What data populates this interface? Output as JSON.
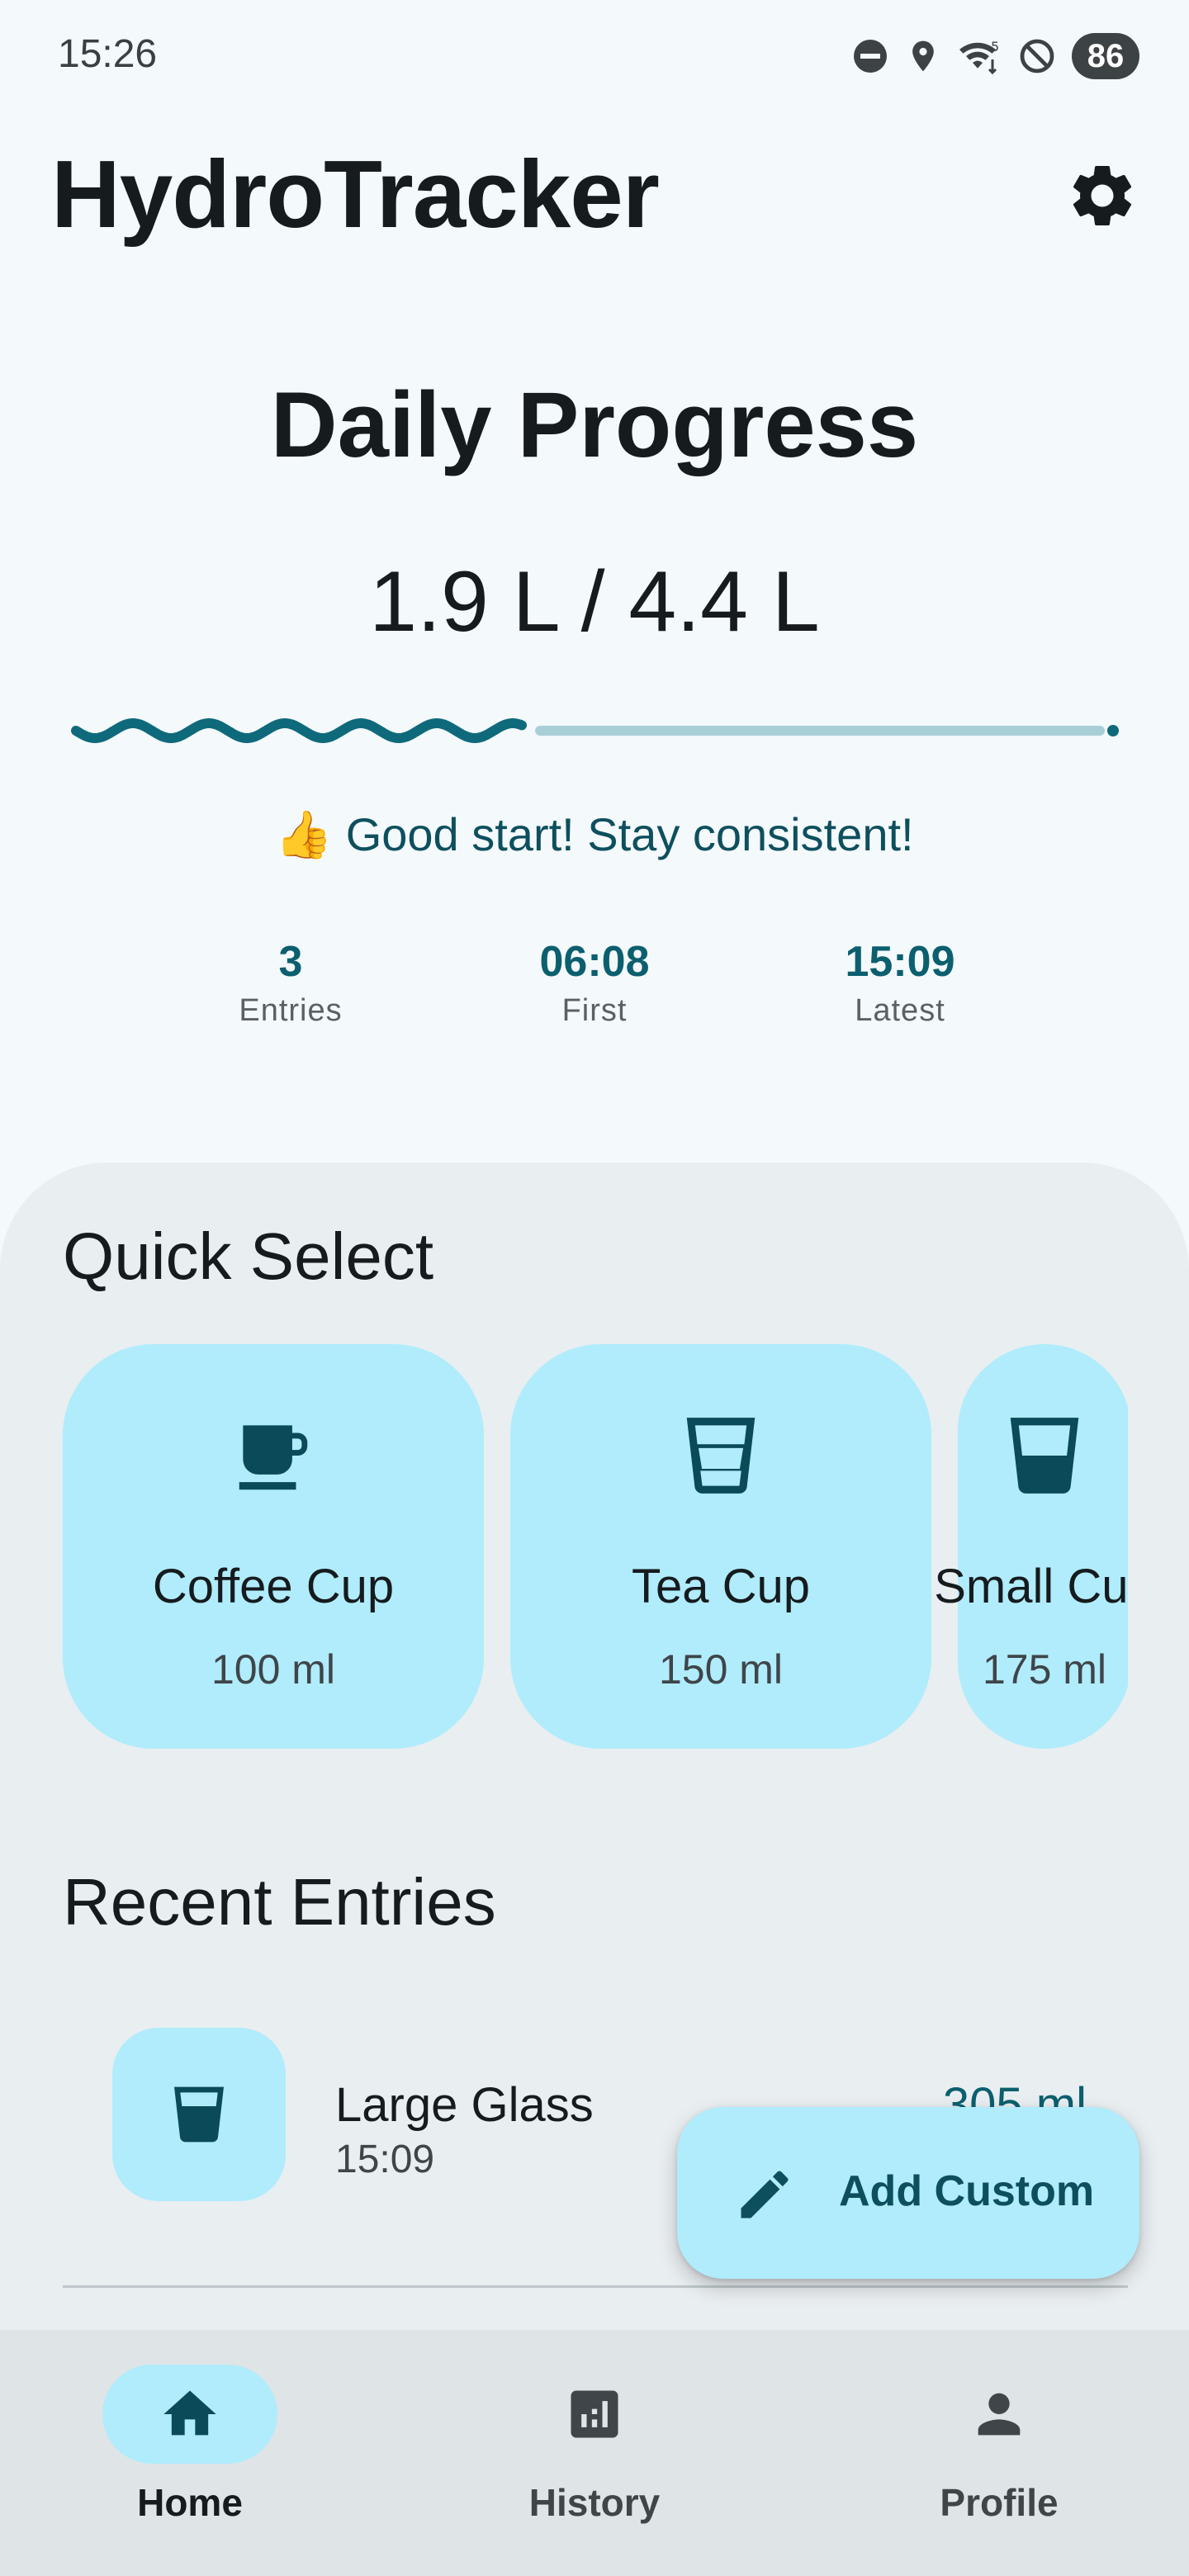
{
  "status_bar": {
    "time": "15:26",
    "battery": "86",
    "icons": [
      "do-not-disturb-icon",
      "location-icon",
      "wifi-icon",
      "blocked-icon",
      "battery-icon"
    ]
  },
  "app_bar": {
    "title": "HydroTracker",
    "settings_icon": "gear-icon"
  },
  "progress": {
    "heading": "Daily Progress",
    "amount": "1.9 L / 4.4 L",
    "consumed_liters": 1.9,
    "goal_liters": 4.4,
    "fraction": 0.43,
    "motivation": "👍 Good start! Stay consistent!"
  },
  "stats": [
    {
      "value": "3",
      "label": "Entries"
    },
    {
      "value": "06:08",
      "label": "First"
    },
    {
      "value": "15:09",
      "label": "Latest"
    }
  ],
  "quick_select": {
    "title": "Quick Select",
    "items": [
      {
        "name": "Coffee Cup",
        "volume": "100 ml",
        "icon": "coffee-cup-icon"
      },
      {
        "name": "Tea Cup",
        "volume": "150 ml",
        "icon": "glass-icon"
      },
      {
        "name": "Small Cup",
        "volume": "175 ml",
        "icon": "glass-icon"
      }
    ]
  },
  "recent_entries": {
    "title": "Recent Entries",
    "items": [
      {
        "name": "Large Glass",
        "time": "15:09",
        "volume": "305 ml",
        "icon": "glass-icon"
      }
    ]
  },
  "fab": {
    "label": "Add Custom",
    "icon": "pencil-icon"
  },
  "bottom_nav": {
    "items": [
      {
        "label": "Home",
        "icon": "home-icon",
        "active": true
      },
      {
        "label": "History",
        "icon": "bar-chart-icon",
        "active": false
      },
      {
        "label": "Profile",
        "icon": "person-icon",
        "active": false
      }
    ]
  },
  "colors": {
    "background": "#f4f9fc",
    "accent": "#0b5f6e",
    "card": "#b0ecfc",
    "sheet": "#e9eef1",
    "track": "#a8cfd7"
  }
}
